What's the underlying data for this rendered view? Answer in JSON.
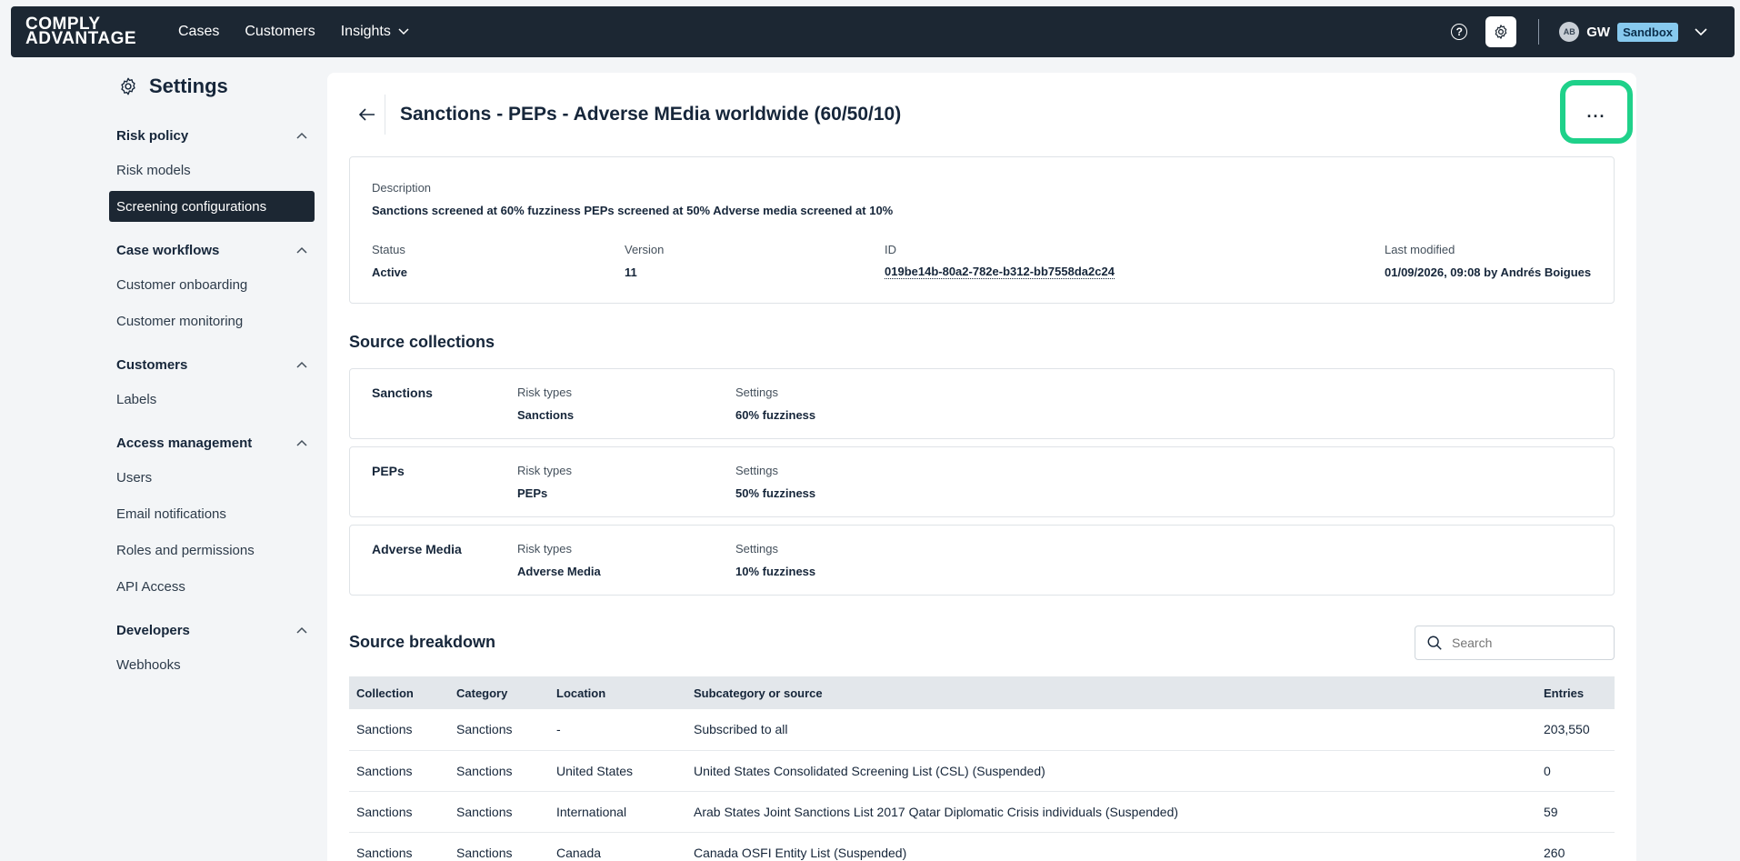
{
  "topnav": {
    "logo_line1": "COMPLY",
    "logo_line2": "ADVANTAGE",
    "items": [
      {
        "label": "Cases"
      },
      {
        "label": "Customers"
      },
      {
        "label": "Insights"
      }
    ],
    "user_avatar": "AB",
    "user_initials": "GW",
    "environment": "Sandbox"
  },
  "sidebar": {
    "title": "Settings",
    "sections": [
      {
        "label": "Risk policy",
        "links": [
          "Risk models",
          "Screening configurations"
        ]
      },
      {
        "label": "Case workflows",
        "links": [
          "Customer onboarding",
          "Customer monitoring"
        ]
      },
      {
        "label": "Customers",
        "links": [
          "Labels"
        ]
      },
      {
        "label": "Access management",
        "links": [
          "Users",
          "Email notifications",
          "Roles and permissions",
          "API Access"
        ]
      },
      {
        "label": "Developers",
        "links": [
          "Webhooks"
        ]
      }
    ],
    "active_link": "Screening configurations"
  },
  "main": {
    "title": "Sanctions - PEPs - Adverse MEdia worldwide (60/50/10)",
    "more_label": "...",
    "description_label": "Description",
    "description": "Sanctions screened at 60% fuzziness PEPs screened at 50% Adverse media screened at 10%",
    "status_label": "Status",
    "status": "Active",
    "version_label": "Version",
    "version": "11",
    "id_label": "ID",
    "id": "019be14b-80a2-782e-b312-bb7558da2c24",
    "modified_label": "Last modified",
    "modified": "01/09/2026, 09:08 by Andrés Boigues",
    "source_collections_title": "Source collections",
    "collections": [
      {
        "name": "Sanctions",
        "risk_label": "Risk types",
        "risk": "Sanctions",
        "settings_label": "Settings",
        "settings": "60% fuzziness"
      },
      {
        "name": "PEPs",
        "risk_label": "Risk types",
        "risk": "PEPs",
        "settings_label": "Settings",
        "settings": "50% fuzziness"
      },
      {
        "name": "Adverse Media",
        "risk_label": "Risk types",
        "risk": "Adverse Media",
        "settings_label": "Settings",
        "settings": "10% fuzziness"
      }
    ],
    "breakdown_title": "Source breakdown",
    "search_placeholder": "Search",
    "table": {
      "headers": [
        "Collection",
        "Category",
        "Location",
        "Subcategory or source",
        "Entries"
      ],
      "rows": [
        [
          "Sanctions",
          "Sanctions",
          "-",
          "Subscribed to all",
          "203,550"
        ],
        [
          "Sanctions",
          "Sanctions",
          "United States",
          "United States Consolidated Screening List (CSL) (Suspended)",
          "0"
        ],
        [
          "Sanctions",
          "Sanctions",
          "International",
          "Arab States Joint Sanctions List 2017 Qatar Diplomatic Crisis individuals (Suspended)",
          "59"
        ],
        [
          "Sanctions",
          "Sanctions",
          "Canada",
          "Canada OSFI Entity List (Suspended)",
          "260"
        ]
      ]
    }
  }
}
